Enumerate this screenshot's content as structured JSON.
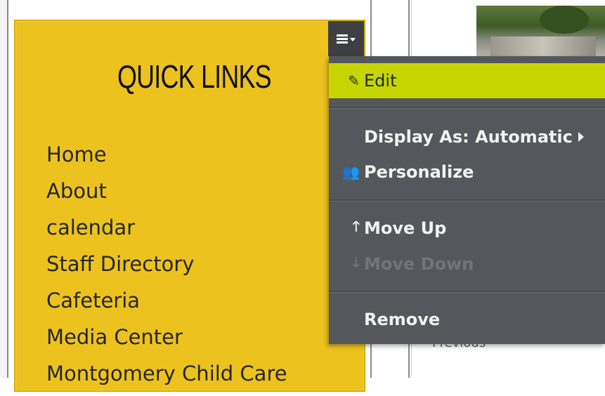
{
  "quick_links": {
    "title": "QUICK LINKS",
    "items": [
      "Home",
      "About",
      "calendar",
      "Staff Directory",
      "Cafeteria",
      "Media Center",
      "Montgomery Child Care"
    ]
  },
  "menu_toggle_icon": "hamburger-menu-icon",
  "dropdown": {
    "edit": "Edit",
    "display_as": "Display As: Automatic",
    "personalize": "Personalize",
    "move_up": "Move Up",
    "move_down": "Move Down",
    "remove": "Remove"
  },
  "right_panel": {
    "previous": "Previous"
  },
  "colors": {
    "quick_links_bg": "#ecc21e",
    "menu_bg": "#54585c",
    "highlight": "#c7d500"
  }
}
